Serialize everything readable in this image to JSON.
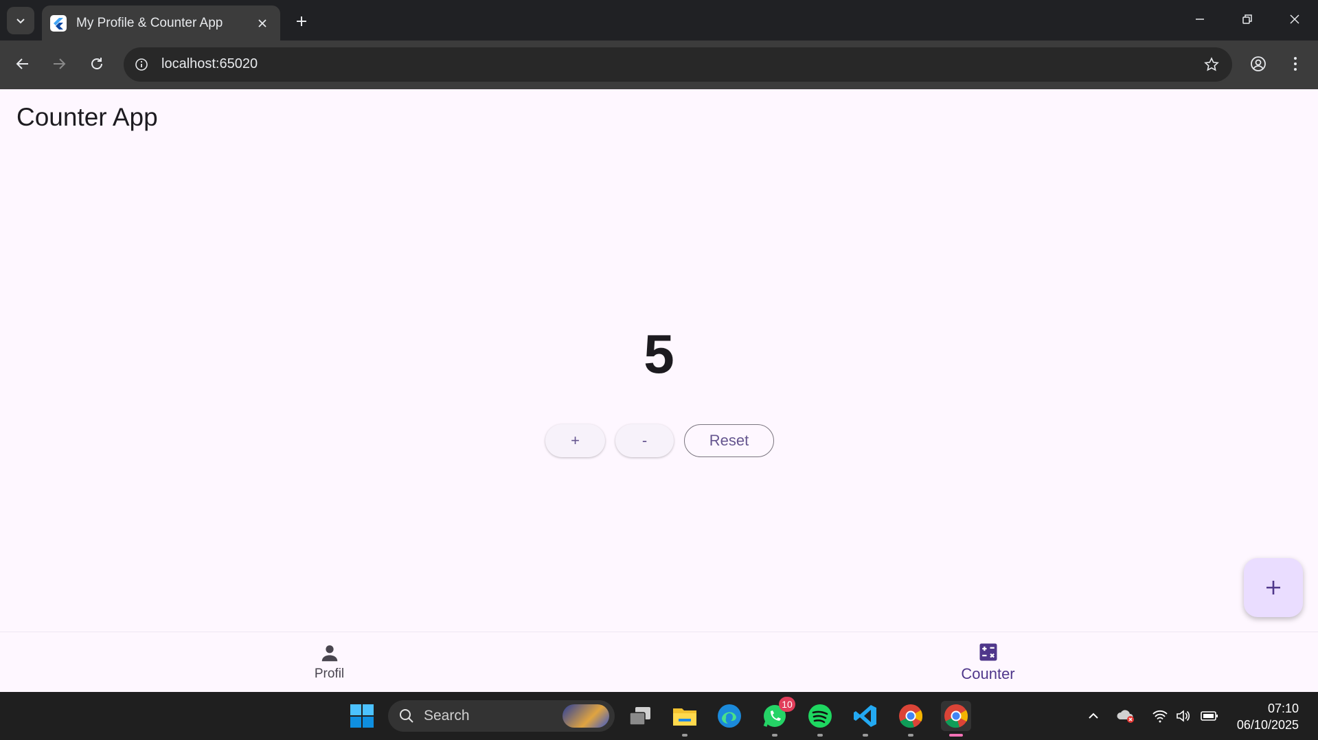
{
  "browser": {
    "tab_title": "My Profile & Counter App",
    "url": "localhost:65020"
  },
  "app": {
    "title": "Counter App",
    "counter_value": "5",
    "buttons": {
      "increment": "+",
      "decrement": "-",
      "reset": "Reset"
    },
    "fab_icon": "plus-icon",
    "bottom_nav": [
      {
        "label": "Profil",
        "icon": "person-icon",
        "active": false
      },
      {
        "label": "Counter",
        "icon": "calculate-icon",
        "active": true
      }
    ]
  },
  "taskbar": {
    "search_placeholder": "Search",
    "whatsapp_badge": "10",
    "time": "07:10",
    "date": "06/10/2025"
  },
  "colors": {
    "app_background": "#fef7ff",
    "primary": "#65558f",
    "fab_background": "#eaddff",
    "active_nav": "#4f378b"
  }
}
